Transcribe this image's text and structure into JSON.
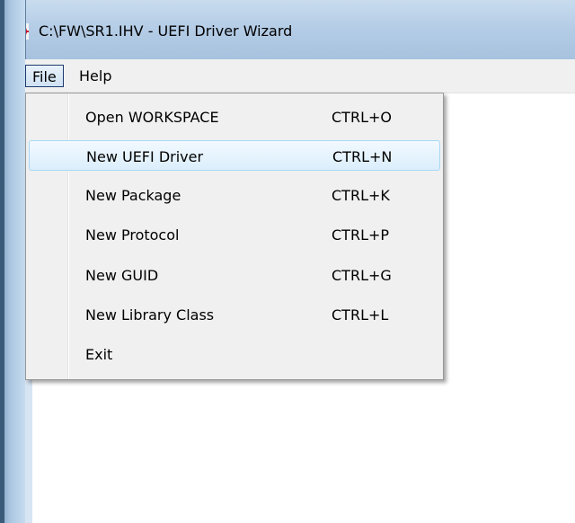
{
  "window": {
    "title": "C:\\FW\\SR1.IHV - UEFI Driver Wizard",
    "app_icon": "red-gear-app-icon"
  },
  "menubar": {
    "items": [
      {
        "label": "File",
        "active": true
      },
      {
        "label": "Help",
        "active": false
      }
    ]
  },
  "file_menu": {
    "items": [
      {
        "label": "Open WORKSPACE",
        "shortcut": "CTRL+O",
        "highlighted": false
      },
      {
        "label": "New UEFI Driver",
        "shortcut": "CTRL+N",
        "highlighted": true
      },
      {
        "label": "New Package",
        "shortcut": "CTRL+K",
        "highlighted": false
      },
      {
        "label": "New Protocol",
        "shortcut": "CTRL+P",
        "highlighted": false
      },
      {
        "label": "New GUID",
        "shortcut": "CTRL+G",
        "highlighted": false
      },
      {
        "label": "New Library Class",
        "shortcut": "CTRL+L",
        "highlighted": false
      },
      {
        "label": "Exit",
        "shortcut": "",
        "highlighted": false
      }
    ]
  },
  "colors": {
    "title_bar": "#b5cde6",
    "menu_background": "#f0f0f0",
    "highlight_border": "#a8d8f5",
    "highlight_fill": "#dbeefc"
  }
}
